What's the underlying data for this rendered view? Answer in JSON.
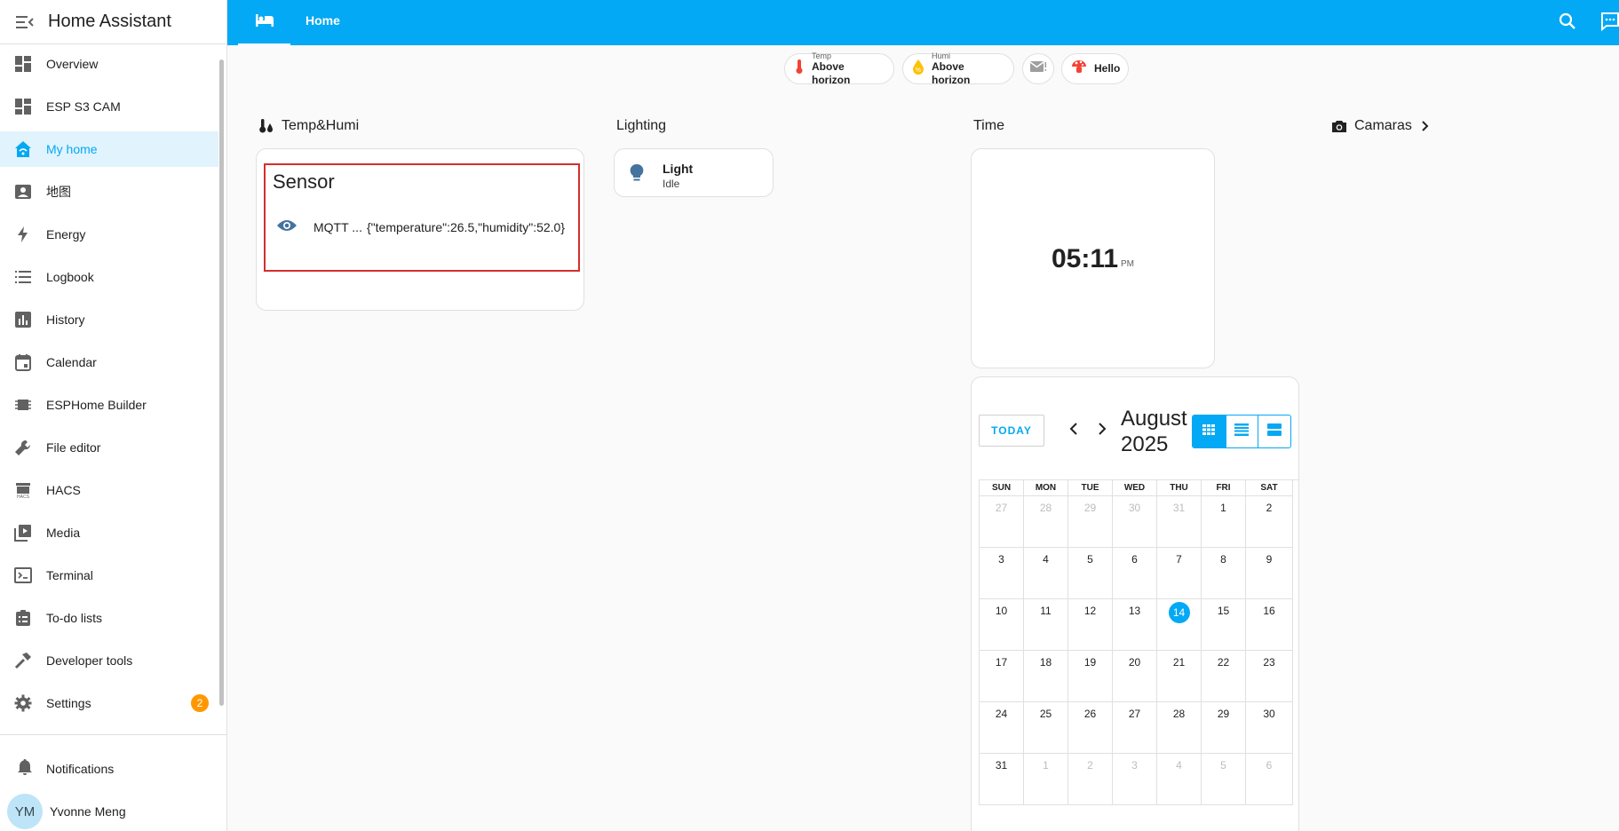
{
  "app": {
    "title": "Home Assistant"
  },
  "sidebar": {
    "items": [
      {
        "label": "Overview"
      },
      {
        "label": "ESP S3 CAM"
      },
      {
        "label": "My home"
      },
      {
        "label": "地图"
      },
      {
        "label": "Energy"
      },
      {
        "label": "Logbook"
      },
      {
        "label": "History"
      },
      {
        "label": "Calendar"
      },
      {
        "label": "ESPHome Builder"
      },
      {
        "label": "File editor"
      },
      {
        "label": "HACS"
      },
      {
        "label": "Media"
      },
      {
        "label": "Terminal"
      },
      {
        "label": "To-do lists"
      },
      {
        "label": "Developer tools"
      },
      {
        "label": "Settings",
        "badge": "2"
      }
    ],
    "notifications": "Notifications",
    "user": {
      "initials": "YM",
      "name": "Yvonne Meng"
    }
  },
  "topbar": {
    "tab": "Home"
  },
  "badges": [
    {
      "small": "Temp",
      "value": "Above horizon"
    },
    {
      "small": "Humi",
      "value": "Above horizon"
    },
    {
      "small": "",
      "value": "Hello"
    }
  ],
  "sections": {
    "temp_humi": "Temp&Humi",
    "lighting": "Lighting",
    "time": "Time",
    "cameras": "Camaras"
  },
  "sensor_card": {
    "title": "Sensor",
    "entity_name": "MQTT ...",
    "state": "{\"temperature\":26.5,\"humidity\":52.0}"
  },
  "light_card": {
    "name": "Light",
    "state": "Idle"
  },
  "clock": {
    "time": "05:11",
    "ampm": "PM"
  },
  "calendar": {
    "today_label": "TODAY",
    "month_label": "August 2025",
    "weekdays": [
      "SUN",
      "MON",
      "TUE",
      "WED",
      "THU",
      "FRI",
      "SAT"
    ],
    "weeks": [
      [
        "27",
        "28",
        "29",
        "30",
        "31",
        "1",
        "2"
      ],
      [
        "3",
        "4",
        "5",
        "6",
        "7",
        "8",
        "9"
      ],
      [
        "10",
        "11",
        "12",
        "13",
        "14",
        "15",
        "16"
      ],
      [
        "17",
        "18",
        "19",
        "20",
        "21",
        "22",
        "23"
      ],
      [
        "24",
        "25",
        "26",
        "27",
        "28",
        "29",
        "30"
      ],
      [
        "31",
        "1",
        "2",
        "3",
        "4",
        "5",
        "6"
      ]
    ],
    "today": "14"
  },
  "colors": {
    "primary": "#03a9f4",
    "badge": "#ff9800",
    "highlight_border": "#d32f2f"
  }
}
